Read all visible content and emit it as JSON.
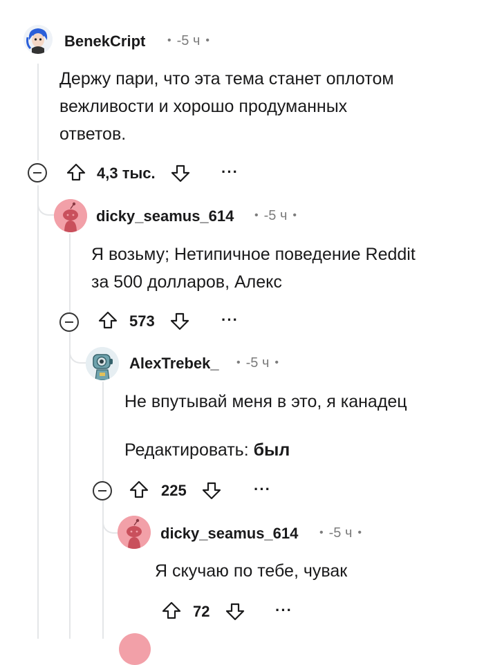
{
  "comments": [
    {
      "author": "BenekCript",
      "time": "-5 ч",
      "body_lines": [
        "Держу пари, что эта тема станет оплотом",
        "вежливости и хорошо продуманных",
        "ответов."
      ],
      "score": "4,3 тыс.",
      "avatar_icon": "cartoon-avatar-blue-hair-icon"
    },
    {
      "author": "dicky_seamus_614",
      "time": "-5 ч",
      "body_lines": [
        "Я возьму; Нетипичное поведение Reddit",
        "за 500 долларов, Алекс"
      ],
      "score": "573",
      "avatar_icon": "snoo-avatar-icon"
    },
    {
      "author": "AlexTrebek_",
      "time": "-5 ч",
      "body_line1": "Не впутывай меня в это, я канадец",
      "edit_prefix": "Редактировать:",
      "edit_bold": "был",
      "score": "225",
      "avatar_icon": "robot-avatar-icon"
    },
    {
      "author": "dicky_seamus_614",
      "time": "-5 ч",
      "body_line1": "Я скучаю по тебе, чувак",
      "score": "72",
      "avatar_icon": "snoo-avatar-icon"
    }
  ],
  "more_label": "···",
  "colors": {
    "snoo_pink": "#f2a0a8",
    "thread_line": "#e4e6e8",
    "meta_gray": "#7c7c7c"
  }
}
